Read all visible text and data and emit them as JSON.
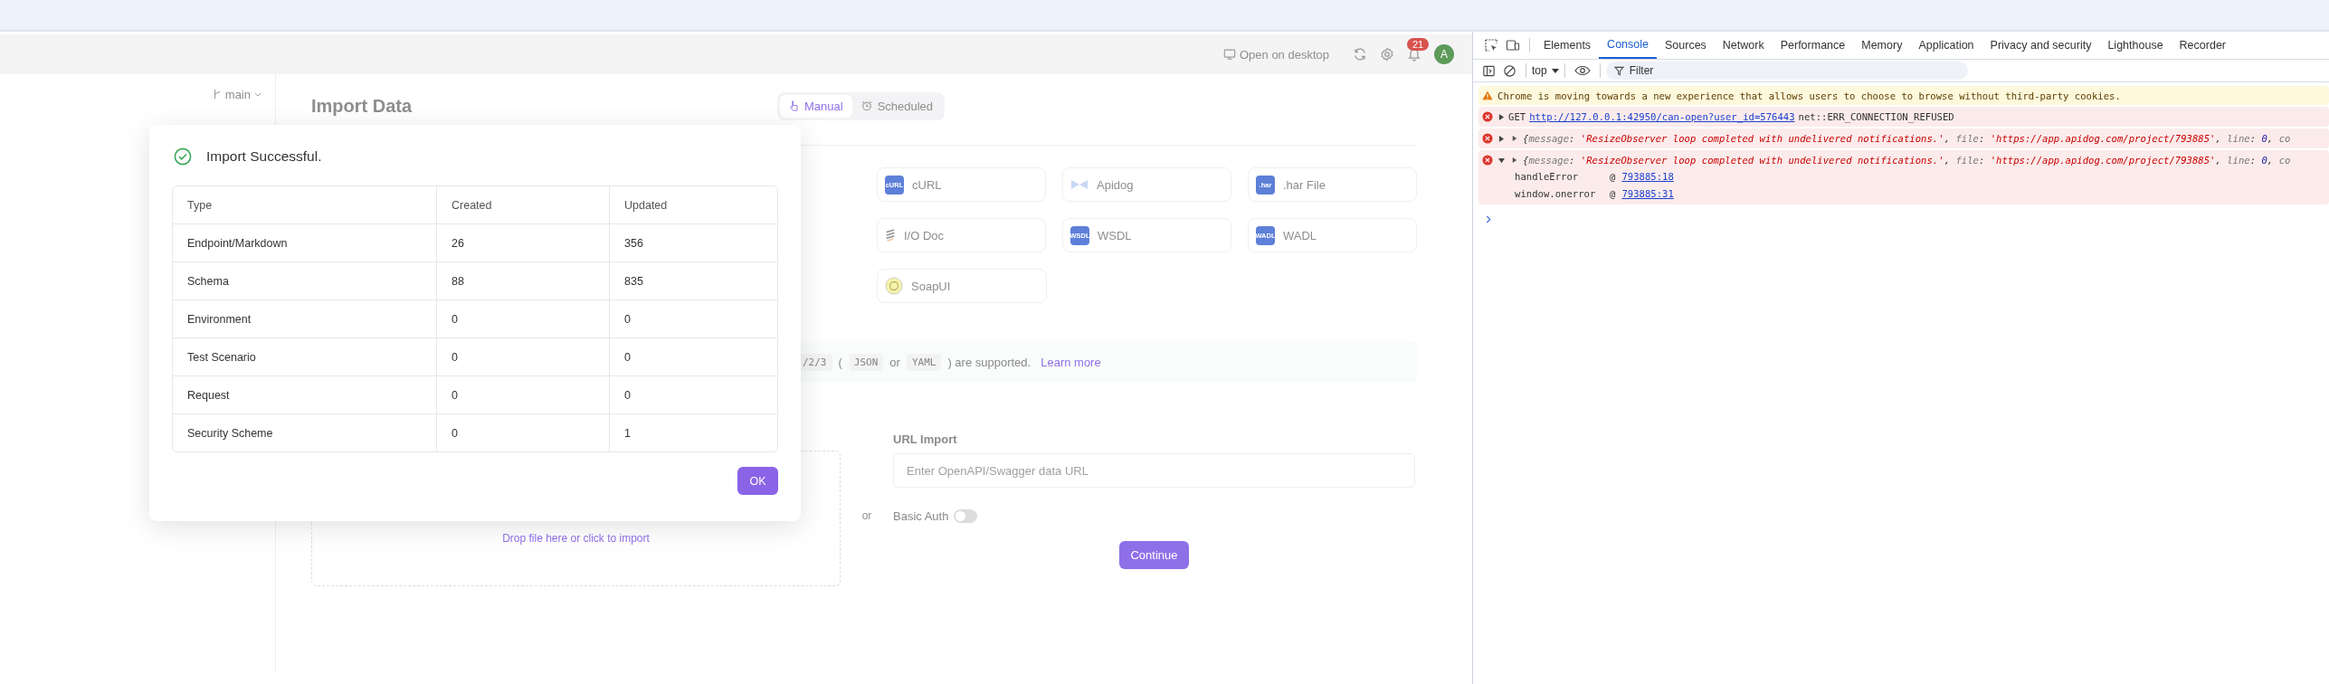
{
  "app": {
    "header": {
      "open_desktop": "Open on desktop",
      "notifications": "21",
      "avatar": "A"
    },
    "branch": "main",
    "title": "Import Data",
    "tabs": [
      {
        "label": "Manual",
        "selected": true,
        "kind": "manual"
      },
      {
        "label": "Scheduled",
        "selected": false,
        "kind": "scheduled"
      }
    ],
    "source_rows": [
      [
        {
          "label": "cURL",
          "kind": "chip",
          "icon_text": "cURL"
        },
        {
          "label": "Apidog",
          "kind": "apidog"
        },
        {
          "label": ".har File",
          "kind": "chip",
          "icon_text": ".har"
        }
      ],
      [
        {
          "label": "I/O Doc",
          "kind": "iodoc"
        },
        {
          "label": "WSDL",
          "kind": "chip",
          "icon_text": "WSDL"
        },
        {
          "label": "WADL",
          "kind": "chip",
          "icon_text": "WADL"
        }
      ],
      [
        {
          "label": "SoapUI",
          "kind": "soapui"
        }
      ]
    ],
    "notice": {
      "segments": [
        {
          "kind": "code",
          "text": "/2/3"
        },
        {
          "kind": "plain",
          "text": "("
        },
        {
          "kind": "code",
          "text": "JSON"
        },
        {
          "kind": "plain",
          "text": "or"
        },
        {
          "kind": "code",
          "text": "YAML"
        },
        {
          "kind": "plain",
          "text": ") are supported."
        }
      ],
      "link": "Learn more"
    },
    "drop_zone": "Drop file here or click to import",
    "divider": "or",
    "url_import": {
      "label": "URL Import",
      "placeholder": "Enter OpenAPI/Swagger data URL"
    },
    "basic_auth": {
      "label": "Basic Auth",
      "on": false
    },
    "continue": "Continue"
  },
  "dialog": {
    "title": "Import Successful.",
    "columns": [
      "Type",
      "Created",
      "Updated"
    ],
    "rows": [
      [
        "Endpoint/Markdown",
        "26",
        "356"
      ],
      [
        "Schema",
        "88",
        "835"
      ],
      [
        "Environment",
        "0",
        "0"
      ],
      [
        "Test Scenario",
        "0",
        "0"
      ],
      [
        "Request",
        "0",
        "0"
      ],
      [
        "Security Scheme",
        "0",
        "1"
      ]
    ],
    "ok": "OK"
  },
  "devtools": {
    "tabs": [
      {
        "label": "Elements",
        "selected": false
      },
      {
        "label": "Console",
        "selected": true
      },
      {
        "label": "Sources",
        "selected": false
      },
      {
        "label": "Network",
        "selected": false
      },
      {
        "label": "Performance",
        "selected": false
      },
      {
        "label": "Memory",
        "selected": false
      },
      {
        "label": "Application",
        "selected": false
      },
      {
        "label": "Privacy and security",
        "selected": false
      },
      {
        "label": "Lighthouse",
        "selected": false
      },
      {
        "label": "Recorder",
        "selected": false
      }
    ],
    "context": "top",
    "filter_placeholder": "Filter",
    "messages": [
      {
        "kind": "warning",
        "text": "Chrome is moving towards a new experience that allows users to choose to browse without third-party cookies."
      },
      {
        "kind": "request",
        "expanded": false,
        "method": "GET",
        "url": "http://127.0.0.1:42950/can-open?user_id=576443",
        "error": "net::ERR_CONNECTION_REFUSED"
      },
      {
        "kind": "object",
        "expanded": false,
        "segments": [
          {
            "kind": "punct",
            "text": "{"
          },
          {
            "kind": "key",
            "text": "message"
          },
          {
            "kind": "punct",
            "text": ": "
          },
          {
            "kind": "string",
            "text": "'ResizeObserver loop completed with undelivered notifications.'"
          },
          {
            "kind": "punct",
            "text": ", "
          },
          {
            "kind": "key",
            "text": "file"
          },
          {
            "kind": "punct",
            "text": ": "
          },
          {
            "kind": "string",
            "text": "'https://app.apidog.com/project/793885'"
          },
          {
            "kind": "punct",
            "text": ", "
          },
          {
            "kind": "key",
            "text": "line"
          },
          {
            "kind": "punct",
            "text": ": "
          },
          {
            "kind": "number",
            "text": "0"
          },
          {
            "kind": "punct",
            "text": ", "
          },
          {
            "kind": "key",
            "text": "co"
          }
        ]
      },
      {
        "kind": "object",
        "expanded": true,
        "segments": [
          {
            "kind": "punct",
            "text": "{"
          },
          {
            "kind": "key",
            "text": "message"
          },
          {
            "kind": "punct",
            "text": ": "
          },
          {
            "kind": "string",
            "text": "'ResizeObserver loop completed with undelivered notifications.'"
          },
          {
            "kind": "punct",
            "text": ", "
          },
          {
            "kind": "key",
            "text": "file"
          },
          {
            "kind": "punct",
            "text": ": "
          },
          {
            "kind": "string",
            "text": "'https://app.apidog.com/project/793885'"
          },
          {
            "kind": "punct",
            "text": ", "
          },
          {
            "kind": "key",
            "text": "line"
          },
          {
            "kind": "punct",
            "text": ": "
          },
          {
            "kind": "number",
            "text": "0"
          },
          {
            "kind": "punct",
            "text": ", "
          },
          {
            "kind": "key",
            "text": "co"
          }
        ],
        "stack": [
          {
            "fn": "handleError",
            "at": "@",
            "loc": "793885:18"
          },
          {
            "fn": "window.onerror",
            "at": "@",
            "loc": "793885:31"
          }
        ]
      }
    ]
  }
}
